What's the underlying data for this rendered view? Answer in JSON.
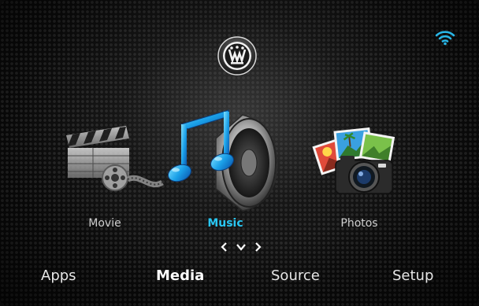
{
  "status": {
    "wifi_icon": "wifi-icon",
    "wifi_color": "#29b6e6"
  },
  "brand": {
    "logo_icon": "westinghouse-logo-icon"
  },
  "media": {
    "items": [
      {
        "label": "Movie",
        "icon": "movie-clapper-icon",
        "selected": false
      },
      {
        "label": "Music",
        "icon": "music-speaker-icon",
        "selected": true
      },
      {
        "label": "Photos",
        "icon": "photos-camera-icon",
        "selected": false
      }
    ],
    "active_color": "#29c6f2"
  },
  "navigation": {
    "left_icon": "chevron-left-icon",
    "down_icon": "chevron-down-icon",
    "right_icon": "chevron-right-icon"
  },
  "menu": {
    "items": [
      {
        "label": "Apps",
        "selected": false
      },
      {
        "label": "Media",
        "selected": true
      },
      {
        "label": "Source",
        "selected": false
      },
      {
        "label": "Setup",
        "selected": false
      }
    ]
  }
}
